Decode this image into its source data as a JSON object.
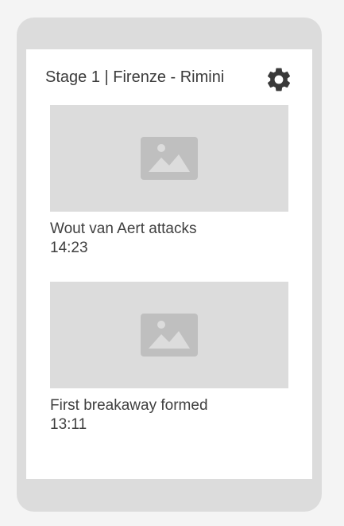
{
  "header": {
    "title": "Stage 1 | Firenze - Rimini",
    "settings_icon": "gear-icon"
  },
  "feed": [
    {
      "title": "Wout van Aert attacks",
      "time": "14:23",
      "thumbnail_icon": "image-placeholder-icon"
    },
    {
      "title": "First breakaway formed",
      "time": "13:11",
      "thumbnail_icon": "image-placeholder-icon"
    }
  ],
  "colors": {
    "device_frame": "#dcdcdc",
    "screen_bg": "#ffffff",
    "page_bg": "#f4f4f4",
    "placeholder_bg": "#dcdcdc",
    "placeholder_icon": "#bfbfbf",
    "text": "#3c3c3c",
    "gear": "#3a3a3a"
  }
}
